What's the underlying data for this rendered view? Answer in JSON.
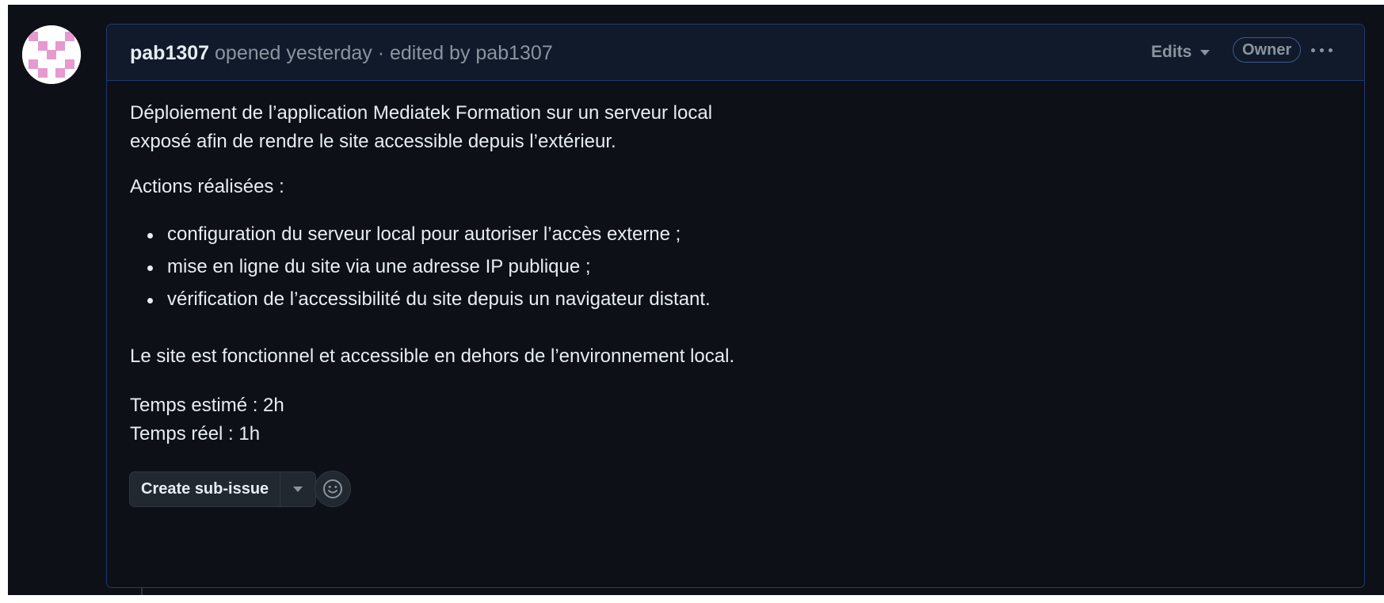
{
  "comment": {
    "author": "pab1307",
    "meta_text": " opened yesterday · edited by pab1307",
    "edits_label": "Edits",
    "owner_badge": "Owner",
    "body": {
      "intro_line1": "Déploiement de l’application Mediatek Formation sur un serveur local",
      "intro_line2": "exposé afin de rendre le site accessible depuis l’extérieur.",
      "actions_heading": "Actions réalisées :",
      "actions": [
        "configuration du serveur local pour autoriser l’accès externe ;",
        "mise en ligne du site via une adresse IP publique ;",
        "vérification de l’accessibilité du site depuis un navigateur distant."
      ],
      "conclusion": "Le site est fonctionnel et accessible en dehors de l’environnement local.",
      "estimated_time": "Temps estimé : 2h",
      "actual_time": "Temps réel : 1h"
    },
    "create_subissue_label": "Create sub-issue"
  },
  "icons": {
    "avatar": "identicon-avatar",
    "edits_caret": "chevron-down-icon",
    "more": "kebab-horizontal-icon",
    "subissue_caret": "triangle-down-icon",
    "emoji": "smiley-icon"
  },
  "colors": {
    "background": "#0d1117",
    "header_bg": "#111a2b",
    "border_accent": "#1f3a6b",
    "text_primary": "#e6edf3",
    "text_muted": "#8b949e",
    "avatar_pink": "#e59ad0"
  }
}
